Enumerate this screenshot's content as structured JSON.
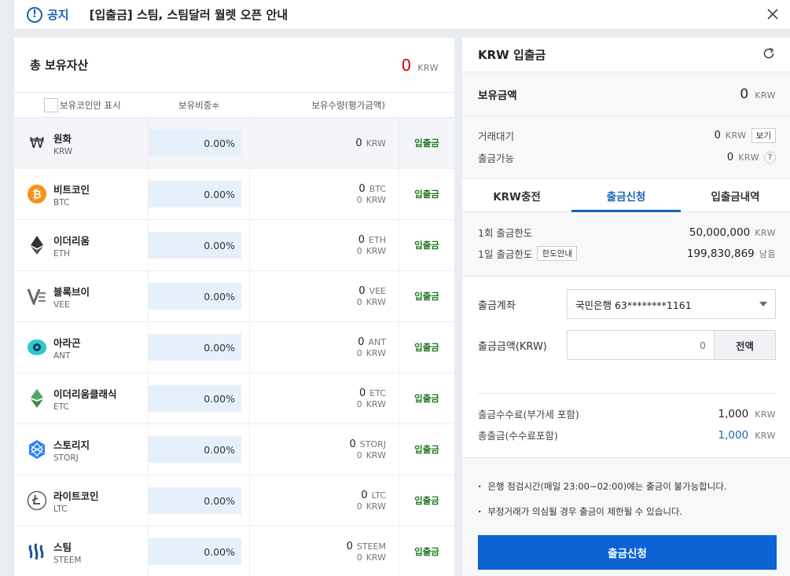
{
  "notice": {
    "label": "공지",
    "text": "[입출금] 스팀, 스팀달러 월렛 오픈 안내"
  },
  "assets": {
    "title": "총 보유자산",
    "total_value": "0",
    "total_unit": "KRW",
    "header": {
      "checkbox_label": "보유코인만 표시",
      "ratio": "보유비중≑",
      "quantity": "보유수량(평가금액)"
    },
    "coins": [
      {
        "name": "원화",
        "symbol": "KRW",
        "ratio": "0.00%",
        "qty": "0",
        "qty_unit": "KRW",
        "value": "",
        "value_unit": "",
        "action": "입출금",
        "icon": "won-icon"
      },
      {
        "name": "비트코인",
        "symbol": "BTC",
        "ratio": "0.00%",
        "qty": "0",
        "qty_unit": "BTC",
        "value": "0",
        "value_unit": "KRW",
        "action": "입출금",
        "icon": "bitcoin-icon"
      },
      {
        "name": "이더리움",
        "symbol": "ETH",
        "ratio": "0.00%",
        "qty": "0",
        "qty_unit": "ETH",
        "value": "0",
        "value_unit": "KRW",
        "action": "입출금",
        "icon": "ethereum-icon"
      },
      {
        "name": "블록브이",
        "symbol": "VEE",
        "ratio": "0.00%",
        "qty": "0",
        "qty_unit": "VEE",
        "value": "0",
        "value_unit": "KRW",
        "action": "입출금",
        "icon": "blockv-icon"
      },
      {
        "name": "아라곤",
        "symbol": "ANT",
        "ratio": "0.00%",
        "qty": "0",
        "qty_unit": "ANT",
        "value": "0",
        "value_unit": "KRW",
        "action": "입출금",
        "icon": "aragon-icon"
      },
      {
        "name": "이더리움클래식",
        "symbol": "ETC",
        "ratio": "0.00%",
        "qty": "0",
        "qty_unit": "ETC",
        "value": "0",
        "value_unit": "KRW",
        "action": "입출금",
        "icon": "ethereum-classic-icon"
      },
      {
        "name": "스토리지",
        "symbol": "STORJ",
        "ratio": "0.00%",
        "qty": "0",
        "qty_unit": "STORJ",
        "value": "0",
        "value_unit": "KRW",
        "action": "입출금",
        "icon": "storj-icon"
      },
      {
        "name": "라이트코인",
        "symbol": "LTC",
        "ratio": "0.00%",
        "qty": "0",
        "qty_unit": "LTC",
        "value": "0",
        "value_unit": "KRW",
        "action": "입출금",
        "icon": "litecoin-icon"
      },
      {
        "name": "스팀",
        "symbol": "STEEM",
        "ratio": "0.00%",
        "qty": "0",
        "qty_unit": "STEEM",
        "value": "0",
        "value_unit": "KRW",
        "action": "입출금",
        "icon": "steem-icon"
      }
    ]
  },
  "krw": {
    "title": "KRW 입출금",
    "holding_label": "보유금액",
    "holding_value": "0",
    "unit": "KRW",
    "pending_label": "거래대기",
    "pending_value": "0",
    "view_button": "보기",
    "available_label": "출금가능",
    "available_value": "0",
    "help": "?",
    "tabs": [
      "KRW충전",
      "출금신청",
      "입출금내역"
    ],
    "limit_once_label": "1회 출금한도",
    "limit_once_value": "50,000,000",
    "limit_day_label": "1일 출금한도",
    "limit_guide_button": "한도안내",
    "limit_day_value": "199,830,869",
    "limit_day_suffix": "남음",
    "account_label": "출금계좌",
    "account_value": "국민은행 63********1161",
    "amount_label": "출금금액(KRW)",
    "amount_placeholder": "0",
    "all_button": "전액",
    "fee_label": "출금수수료(부가세 포함)",
    "fee_value": "1,000",
    "total_label": "총출금(수수료포함)",
    "total_value": "1,000",
    "notes": [
      "은행 점검시간(매일 23:00~02:00)에는 출금이 불가능합니다.",
      "부정거래가 의심될 경우 출금이 제한될 수 있습니다."
    ],
    "submit": "출금신청"
  },
  "colors": {
    "accent": "#1763b6",
    "negative": "#d60000",
    "action_green": "#1a7a1a",
    "submit_blue": "#0b63d4"
  }
}
